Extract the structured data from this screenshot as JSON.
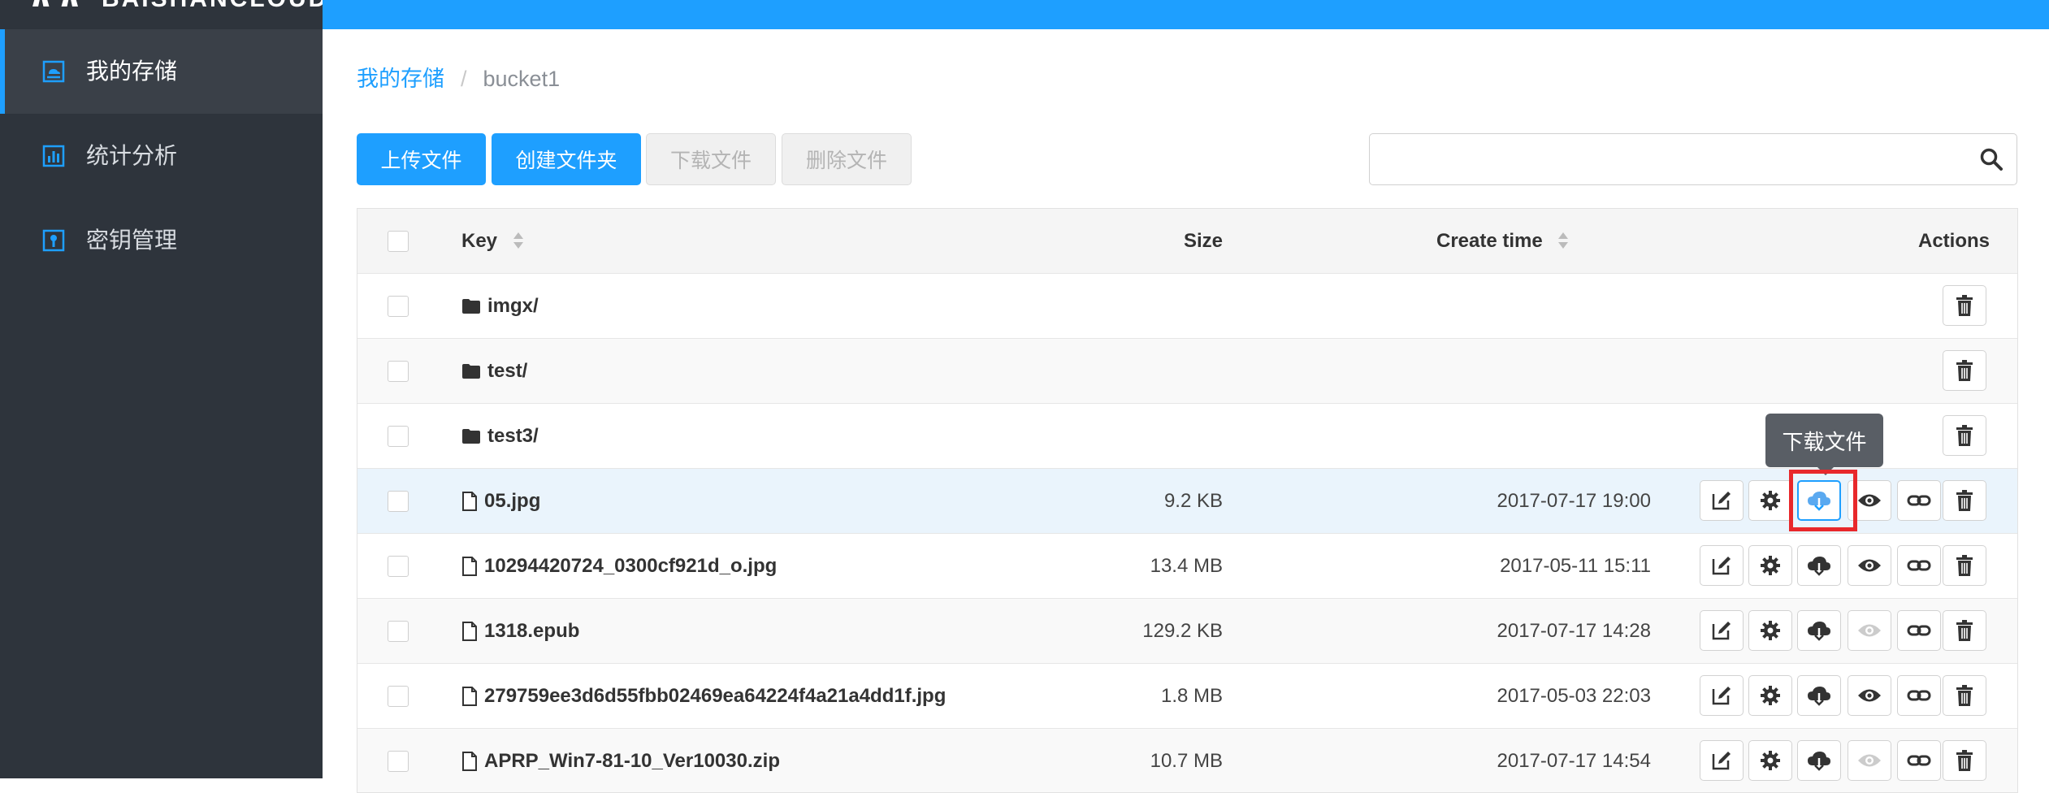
{
  "app": {
    "logo_text": "BAISHANCLOUD"
  },
  "sidebar": {
    "items": [
      {
        "label": "我的存储",
        "icon": "storage-icon",
        "active": true
      },
      {
        "label": "统计分析",
        "icon": "chart-icon",
        "active": false
      },
      {
        "label": "密钥管理",
        "icon": "key-icon",
        "active": false
      }
    ]
  },
  "breadcrumb": {
    "root": "我的存储",
    "separator": "/",
    "current": "bucket1"
  },
  "toolbar": {
    "upload": "上传文件",
    "create_folder": "创建文件夹",
    "download": "下载文件",
    "delete": "删除文件"
  },
  "search": {
    "value": "",
    "placeholder": ""
  },
  "table": {
    "columns": {
      "key": "Key",
      "size": "Size",
      "create_time": "Create time",
      "actions": "Actions"
    },
    "rows": [
      {
        "type": "folder",
        "key": "imgx/",
        "size": "",
        "time": ""
      },
      {
        "type": "folder",
        "key": "test/",
        "size": "",
        "time": ""
      },
      {
        "type": "folder",
        "key": "test3/",
        "size": "",
        "time": ""
      },
      {
        "type": "file",
        "key": "05.jpg",
        "size": "9.2 KB",
        "time": "2017-07-17 19:00",
        "previewable": true,
        "highlighted": true
      },
      {
        "type": "file",
        "key": "10294420724_0300cf921d_o.jpg",
        "size": "13.4 MB",
        "time": "2017-05-11 15:11",
        "previewable": true
      },
      {
        "type": "file",
        "key": "1318.epub",
        "size": "129.2 KB",
        "time": "2017-07-17 14:28",
        "previewable": false
      },
      {
        "type": "file",
        "key": "279759ee3d6d55fbb02469ea64224f4a21a4dd1f.jpg",
        "size": "1.8 MB",
        "time": "2017-05-03 22:03",
        "previewable": true
      },
      {
        "type": "file",
        "key": "APRP_Win7-81-10_Ver10030.zip",
        "size": "10.7 MB",
        "time": "2017-07-17 14:54",
        "previewable": false
      }
    ]
  },
  "tooltip": {
    "text": "下载文件"
  },
  "colors": {
    "accent": "#1e9fff",
    "sidebar_bg": "#2e343c",
    "highlight_box": "#e8282b"
  }
}
